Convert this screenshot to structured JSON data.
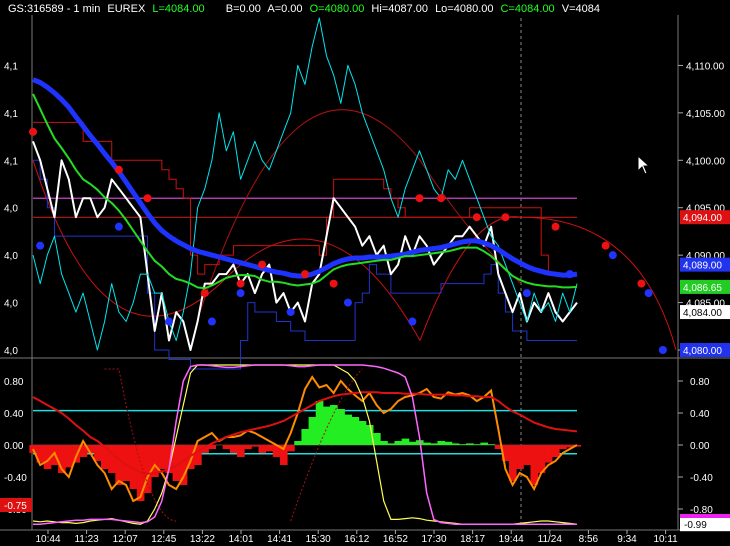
{
  "header": {
    "symbol": "GS:316589 - 1 min",
    "exchange": "EUREX",
    "last": "L=4084.00",
    "bid": "B=0.00",
    "ask": "A=0.00",
    "open": "O=4080.00",
    "high": "Hi=4087.00",
    "low": "Lo=4080.00",
    "close": "C=4084.00",
    "volume": "V=4084"
  },
  "chart_data": [
    {
      "type": "line",
      "panel": "price",
      "ylim": [
        4080,
        4115
      ],
      "right_ticks": [
        "4,110.00",
        "4,105.00",
        "4,100.00",
        "4,095.00",
        "4,090.00",
        "4,085.00",
        "4,080.00"
      ],
      "right_tick_values": [
        4110,
        4105,
        4100,
        4095,
        4090,
        4085,
        4080
      ],
      "left_ticks": [
        "4,1",
        "4,1",
        "4,1",
        "4,0",
        "4,0",
        "4,0",
        "4,0"
      ],
      "price_tags": [
        {
          "label": "4,094.00",
          "value": 4094.0,
          "color": "#dd1111"
        },
        {
          "label": "4,089.00",
          "value": 4089.0,
          "color": "#2233ee"
        },
        {
          "label": "4,086.65",
          "value": 4086.65,
          "color": "#22cc22"
        },
        {
          "label": "4,084.00",
          "value": 4084.0,
          "color": "#ffffff"
        },
        {
          "label": "4,080.00",
          "value": 4080.0,
          "color": "#2233ee"
        }
      ],
      "series": [
        {
          "color": "#ffffff",
          "values": [
            4102,
            4100,
            4097,
            4094,
            4100,
            4098,
            4094,
            4096,
            4096,
            4094,
            4095,
            4098,
            4097,
            4096,
            4095,
            4094,
            4088,
            4082,
            4086,
            4081,
            4084,
            4083,
            4080,
            4083,
            4087,
            4087,
            4088,
            4088,
            4089,
            4087,
            4088,
            4086,
            4088,
            4089,
            4085,
            4086,
            4084,
            4085,
            4083,
            4087,
            4088,
            4092,
            4096,
            4095,
            4094,
            4093,
            4091,
            4092,
            4090,
            4091,
            4088,
            4089,
            4092,
            4090,
            4092,
            4091,
            4089,
            4090,
            4091,
            4092,
            4092,
            4093,
            4092,
            4091,
            4093,
            4088,
            4086,
            4084,
            4086,
            4083,
            4085,
            4084,
            4086,
            4084,
            4083,
            4084,
            4085
          ]
        },
        {
          "color": "#00e5ee",
          "values": [
            4090,
            4087,
            4090,
            4092,
            4088,
            4086,
            4084,
            4086,
            4083,
            4080,
            4083,
            4087,
            4084,
            4083,
            4085,
            4088,
            4088,
            4086,
            4086,
            4083,
            4081,
            4084,
            4088,
            4095,
            4097,
            4100,
            4105,
            4101,
            4103,
            4098,
            4100,
            4102,
            4100,
            4099,
            4101,
            4103,
            4105,
            4110,
            4108,
            4112,
            4115,
            4111,
            4109,
            4106,
            4110,
            4108,
            4105,
            4103,
            4101,
            4099,
            4096,
            4094,
            4097,
            4099,
            4101,
            4099,
            4097,
            4096,
            4099,
            4098,
            4100,
            4098,
            4096,
            4094,
            4092,
            4091,
            4089,
            4087,
            4085,
            4083,
            4086,
            4084,
            4085,
            4083,
            4086,
            4084,
            4087
          ]
        },
        {
          "color": "#1f33ff",
          "values": [
            4108.5,
            4108.2,
            4107.7,
            4107.1,
            4106.4,
            4105.6,
            4104.6,
            4103.6,
            4102.6,
            4101.7,
            4100.7,
            4099.8,
            4098.8,
            4097.7,
            4096.6,
            4095.5,
            4094.4,
            4093.4,
            4092.6,
            4092.0,
            4091.5,
            4091.1,
            4090.7,
            4090.4,
            4090.2,
            4090.0,
            4089.8,
            4089.6,
            4089.4,
            4089.2,
            4089.0,
            4088.8,
            4088.6,
            4088.4,
            4088.2,
            4088.1,
            4087.9,
            4087.8,
            4087.8,
            4088.0,
            4088.3,
            4088.7,
            4089.1,
            4089.4,
            4089.6,
            4089.7,
            4089.7,
            4089.8,
            4089.8,
            4089.8,
            4089.9,
            4090.0,
            4090.1,
            4090.3,
            4090.5,
            4090.6,
            4090.7,
            4090.8,
            4091.0,
            4091.2,
            4091.4,
            4091.5,
            4091.5,
            4091.3,
            4091.0,
            4090.6,
            4090.1,
            4089.6,
            4089.2,
            4088.8,
            4088.5,
            4088.3,
            4088.1,
            4088.0,
            4087.9,
            4087.9,
            4088.0
          ]
        },
        {
          "color": "#22dd22",
          "values": [
            4107.0,
            4105.4,
            4103.8,
            4102.3,
            4101.3,
            4100.2,
            4099.0,
            4098.0,
            4097.5,
            4096.9,
            4096.1,
            4095.5,
            4094.7,
            4093.7,
            4092.6,
            4091.5,
            4090.4,
            4089.4,
            4088.8,
            4088.0,
            4087.5,
            4087.3,
            4087.0,
            4086.6,
            4086.5,
            4086.8,
            4087.2,
            4087.6,
            4087.8,
            4087.9,
            4087.9,
            4087.8,
            4087.4,
            4087.2,
            4087.2,
            4087.1,
            4086.9,
            4086.8,
            4086.9,
            4087.0,
            4087.3,
            4087.9,
            4088.5,
            4088.8,
            4089.0,
            4089.1,
            4089.2,
            4089.3,
            4089.4,
            4089.5,
            4089.5,
            4089.7,
            4089.9,
            4089.9,
            4090.0,
            4090.1,
            4090.2,
            4090.3,
            4090.4,
            4090.6,
            4090.8,
            4090.8,
            4090.8,
            4090.4,
            4089.9,
            4089.2,
            4088.5,
            4087.8,
            4087.4,
            4087.1,
            4086.9,
            4086.8,
            4086.7,
            4086.7,
            4086.6,
            4086.6,
            4086.65
          ]
        }
      ],
      "red_dots": [
        [
          0,
          4103
        ],
        [
          12,
          4099
        ],
        [
          16,
          4096
        ],
        [
          24,
          4086
        ],
        [
          29,
          4087
        ],
        [
          32,
          4089
        ],
        [
          38,
          4088
        ],
        [
          42,
          4087
        ],
        [
          54,
          4096
        ],
        [
          57,
          4096
        ],
        [
          62,
          4094
        ],
        [
          66,
          4094
        ],
        [
          73,
          4093
        ],
        [
          80,
          4091
        ],
        [
          85,
          4087
        ]
      ],
      "blue_dots": [
        [
          1,
          4091
        ],
        [
          12,
          4093
        ],
        [
          19,
          4083
        ],
        [
          25,
          4083
        ],
        [
          29,
          4086
        ],
        [
          36,
          4084
        ],
        [
          44,
          4085
        ],
        [
          53,
          4083
        ],
        [
          69,
          4086
        ],
        [
          75,
          4088
        ],
        [
          81,
          4090
        ],
        [
          86,
          4086
        ],
        [
          88,
          4080
        ]
      ]
    },
    {
      "type": "area",
      "panel": "oscillator",
      "ylim": [
        -1,
        1
      ],
      "right_ticks": [
        "0.80",
        "0.40",
        "0.00",
        "-0.40",
        "-0.80"
      ],
      "right_tick_values": [
        0.8,
        0.4,
        0.0,
        -0.4,
        -0.8
      ],
      "left_ticks": [
        "0.80",
        "0.40",
        "0.00",
        "-0.40",
        "-0.80"
      ],
      "tags": [
        {
          "label": "-0.75",
          "value": -0.75,
          "color": "#dd1111",
          "side": "left"
        },
        {
          "label": "-0.99",
          "value": -0.99,
          "color": "#ffffff",
          "side": "right"
        }
      ],
      "levels": [
        0.43,
        -0.11
      ],
      "histogram": [
        -0.1,
        -0.22,
        -0.3,
        -0.25,
        -0.35,
        -0.28,
        -0.22,
        -0.15,
        -0.1,
        -0.2,
        -0.3,
        -0.35,
        -0.5,
        -0.45,
        -0.55,
        -0.7,
        -0.6,
        -0.4,
        -0.3,
        -0.35,
        -0.45,
        -0.5,
        -0.3,
        -0.25,
        -0.1,
        -0.05,
        0,
        -0.05,
        -0.1,
        -0.15,
        -0.05,
        -0.02,
        -0.1,
        -0.08,
        -0.15,
        -0.25,
        -0.08,
        0.05,
        0.2,
        0.35,
        0.55,
        0.48,
        0.5,
        0.45,
        0.38,
        0.35,
        0.3,
        0.25,
        0.15,
        0.05,
        0.02,
        0.05,
        0.08,
        0.04,
        0.06,
        0.03,
        0.02,
        0.05,
        0.04,
        0.02,
        0.01,
        0.02,
        0.01,
        0.03,
        0.01,
        -0.05,
        -0.2,
        -0.45,
        -0.3,
        -0.25,
        -0.5,
        -0.35,
        -0.22,
        -0.15,
        -0.05,
        -0.03,
        -0.02
      ],
      "series": [
        {
          "color": "#ff8c00",
          "values": [
            -0.05,
            -0.25,
            -0.2,
            -0.1,
            -0.3,
            -0.4,
            -0.15,
            0.05,
            -0.1,
            -0.25,
            -0.35,
            -0.55,
            -0.45,
            -0.5,
            -0.7,
            -0.65,
            -0.4,
            -0.25,
            -0.35,
            -0.5,
            -0.55,
            -0.4,
            -0.2,
            0.05,
            0.1,
            0.15,
            0.05,
            0.1,
            0.1,
            0.12,
            0.18,
            0.15,
            0.1,
            0.05,
            0.0,
            -0.05,
            0.15,
            0.4,
            0.7,
            0.85,
            0.72,
            0.75,
            0.65,
            0.8,
            0.7,
            0.62,
            0.55,
            0.65,
            0.5,
            0.4,
            0.45,
            0.55,
            0.6,
            0.62,
            0.65,
            0.7,
            0.6,
            0.58,
            0.66,
            0.63,
            0.65,
            0.62,
            0.55,
            0.6,
            0.68,
            0.2,
            -0.3,
            -0.5,
            -0.35,
            -0.4,
            -0.55,
            -0.35,
            -0.25,
            -0.2,
            -0.1,
            -0.05,
            0.0
          ]
        },
        {
          "color": "#dd1111",
          "values": [
            0.6,
            0.55,
            0.5,
            0.45,
            0.4,
            0.33,
            0.25,
            0.18,
            0.1,
            0.05,
            -0.02,
            -0.1,
            -0.18,
            -0.25,
            -0.3,
            -0.34,
            -0.36,
            -0.35,
            -0.33,
            -0.3,
            -0.26,
            -0.2,
            -0.14,
            -0.08,
            -0.03,
            0.02,
            0.06,
            0.1,
            0.13,
            0.16,
            0.18,
            0.2,
            0.22,
            0.24,
            0.27,
            0.3,
            0.35,
            0.4,
            0.45,
            0.5,
            0.55,
            0.58,
            0.61,
            0.63,
            0.64,
            0.65,
            0.66,
            0.66,
            0.66,
            0.65,
            0.65,
            0.65,
            0.64,
            0.64,
            0.64,
            0.63,
            0.63,
            0.63,
            0.63,
            0.62,
            0.62,
            0.61,
            0.61,
            0.6,
            0.6,
            0.55,
            0.48,
            0.42,
            0.38,
            0.33,
            0.28,
            0.25,
            0.22,
            0.2,
            0.19,
            0.18,
            0.17
          ]
        },
        {
          "color": "#ffff55",
          "values": [
            -0.95,
            -0.96,
            -0.95,
            -0.96,
            -0.97,
            -0.97,
            -0.98,
            -0.97,
            -0.95,
            -0.94,
            -0.93,
            -0.92,
            -0.94,
            -0.96,
            -0.98,
            -0.99,
            -0.95,
            -0.8,
            -0.6,
            -0.3,
            0.1,
            0.5,
            0.9,
            1.0,
            1.0,
            1.0,
            1.0,
            1.0,
            1.0,
            1.0,
            1.0,
            1.0,
            1.0,
            1.0,
            1.0,
            1.0,
            1.0,
            1.0,
            1.0,
            1.0,
            1.0,
            1.0,
            1.0,
            0.95,
            0.9,
            0.8,
            0.6,
            0.3,
            -0.2,
            -0.7,
            -0.93,
            -0.93,
            -0.92,
            -0.91,
            -0.92,
            -0.94,
            -0.95,
            -0.96,
            -0.97,
            -0.98,
            -0.99,
            -0.99,
            -0.99,
            -0.99,
            -0.99,
            -0.99,
            -0.99,
            -0.99,
            -0.98,
            -0.97,
            -0.96,
            -0.95,
            -0.95,
            -0.96,
            -0.97,
            -0.98,
            -0.99
          ]
        },
        {
          "color": "#ff66ff",
          "values": [
            -0.99,
            -0.99,
            -0.98,
            -0.97,
            -0.96,
            -0.95,
            -0.94,
            -0.94,
            -0.93,
            -0.93,
            -0.93,
            -0.93,
            -0.94,
            -0.95,
            -0.96,
            -0.97,
            -0.96,
            -0.9,
            -0.7,
            -0.3,
            0.3,
            0.8,
            0.98,
            1.0,
            1.0,
            0.99,
            0.98,
            0.97,
            0.97,
            0.98,
            0.99,
            1.0,
            1.0,
            1.0,
            1.0,
            1.0,
            0.99,
            0.98,
            0.98,
            0.99,
            1.0,
            1.0,
            1.0,
            1.0,
            1.0,
            1.0,
            1.0,
            0.99,
            0.98,
            0.96,
            0.93,
            0.9,
            0.85,
            0.6,
            0.1,
            -0.6,
            -0.93,
            -0.97,
            -0.98,
            -0.99,
            -0.99,
            -0.99,
            -0.99,
            -0.99,
            -0.99,
            -0.99,
            -0.99,
            -0.99,
            -0.99,
            -0.99,
            -0.99,
            -0.99,
            -0.99,
            -0.99,
            -0.99,
            -0.99,
            -0.99
          ]
        }
      ]
    }
  ],
  "x_axis": {
    "ticks": [
      "10:44",
      "11:23",
      "12:07",
      "12:45",
      "13:22",
      "14:01",
      "14:41",
      "15:30",
      "16:12",
      "16:52",
      "17:30",
      "18:17",
      "19:44",
      "11/24",
      "8:56",
      "9:34",
      "10:11"
    ]
  }
}
